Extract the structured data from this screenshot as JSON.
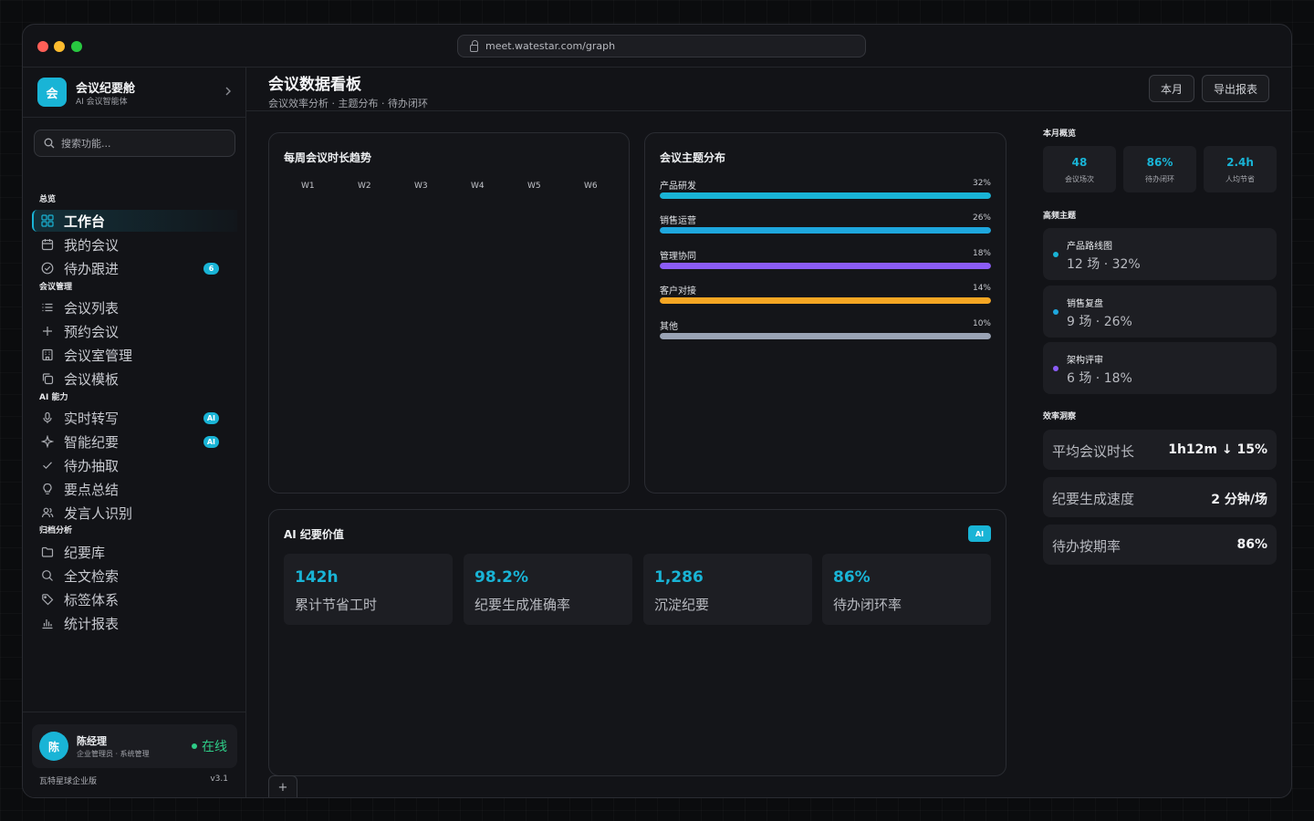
{
  "browser": {
    "url": "meet.watestar.com/graph"
  },
  "brand": {
    "logo": "会",
    "name": "会议纪要舱",
    "subtitle": "AI 会议智能体"
  },
  "search": {
    "placeholder": "搜索功能..."
  },
  "nav": {
    "groups": [
      {
        "title": "总览",
        "items": [
          {
            "label": "工作台",
            "icon": "grid-icon",
            "active": true
          },
          {
            "label": "我的会议",
            "icon": "calendar-icon"
          },
          {
            "label": "待办跟进",
            "icon": "check-circle-icon",
            "badge": "6"
          }
        ]
      },
      {
        "title": "会议管理",
        "items": [
          {
            "label": "会议列表",
            "icon": "list-icon"
          },
          {
            "label": "预约会议",
            "icon": "plus-icon"
          },
          {
            "label": "会议室管理",
            "icon": "building-icon"
          },
          {
            "label": "会议模板",
            "icon": "copy-icon"
          }
        ]
      },
      {
        "title": "AI 能力",
        "items": [
          {
            "label": "实时转写",
            "icon": "mic-icon",
            "badge": "AI"
          },
          {
            "label": "智能纪要",
            "icon": "sparkle-icon",
            "badge": "AI"
          },
          {
            "label": "待办抽取",
            "icon": "check-icon"
          },
          {
            "label": "要点总结",
            "icon": "bulb-icon"
          },
          {
            "label": "发言人识别",
            "icon": "users-icon"
          }
        ]
      },
      {
        "title": "归档分析",
        "items": [
          {
            "label": "纪要库",
            "icon": "folder-icon"
          },
          {
            "label": "全文检索",
            "icon": "search-icon"
          },
          {
            "label": "标签体系",
            "icon": "tag-icon"
          },
          {
            "label": "统计报表",
            "icon": "bar-chart-icon"
          }
        ]
      }
    ]
  },
  "user": {
    "avatar": "陈",
    "name": "陈经理",
    "role": "企业管理员 · 系统管理",
    "status": "在线"
  },
  "footer": {
    "edition": "瓦特星球企业版",
    "version": "v3.1"
  },
  "header": {
    "title": "会议数据看板",
    "subtitle": "会议效率分析 · 主题分布 · 待办闭环",
    "btn_month": "本月",
    "btn_export": "导出报表"
  },
  "weekly_trend": {
    "title": "每周会议时长趋势",
    "weeks": [
      "W1",
      "W2",
      "W3",
      "W4",
      "W5",
      "W6"
    ]
  },
  "topics": {
    "title": "会议主题分布",
    "items": [
      {
        "name": "产品研发",
        "pct": "32%",
        "color": "#19b4d6"
      },
      {
        "name": "销售运营",
        "pct": "26%",
        "color": "#1ea7de"
      },
      {
        "name": "管理协同",
        "pct": "18%",
        "color": "#8b5cf6"
      },
      {
        "name": "客户对接",
        "pct": "14%",
        "color": "#f5a623"
      },
      {
        "name": "其他",
        "pct": "10%",
        "color": "#9aa3b5"
      }
    ]
  },
  "ai_value": {
    "title": "AI 纪要价值",
    "badge": "AI",
    "cards": [
      {
        "value": "142h",
        "label": "累计节省工时"
      },
      {
        "value": "98.2%",
        "label": "纪要生成准确率"
      },
      {
        "value": "1,286",
        "label": "沉淀纪要"
      },
      {
        "value": "86%",
        "label": "待办闭环率"
      }
    ]
  },
  "overview": {
    "title": "本月概览",
    "stats": [
      {
        "value": "48",
        "label": "会议场次"
      },
      {
        "value": "86%",
        "label": "待办闭环"
      },
      {
        "value": "2.4h",
        "label": "人均节省"
      }
    ]
  },
  "hot_topics": {
    "title": "高频主题",
    "items": [
      {
        "name": "产品路线图",
        "meta": "12 场 · 32%",
        "color": "#19b4d6"
      },
      {
        "name": "销售复盘",
        "meta": "9 场 · 26%",
        "color": "#1ea7de"
      },
      {
        "name": "架构评审",
        "meta": "6 场 · 18%",
        "color": "#8b5cf6"
      }
    ]
  },
  "efficiency": {
    "title": "效率洞察",
    "items": [
      {
        "label": "平均会议时长",
        "value": "1h12m ↓ 15%"
      },
      {
        "label": "纪要生成速度",
        "value": "2 分钟/场"
      },
      {
        "label": "待办按期率",
        "value": "86%"
      }
    ]
  }
}
